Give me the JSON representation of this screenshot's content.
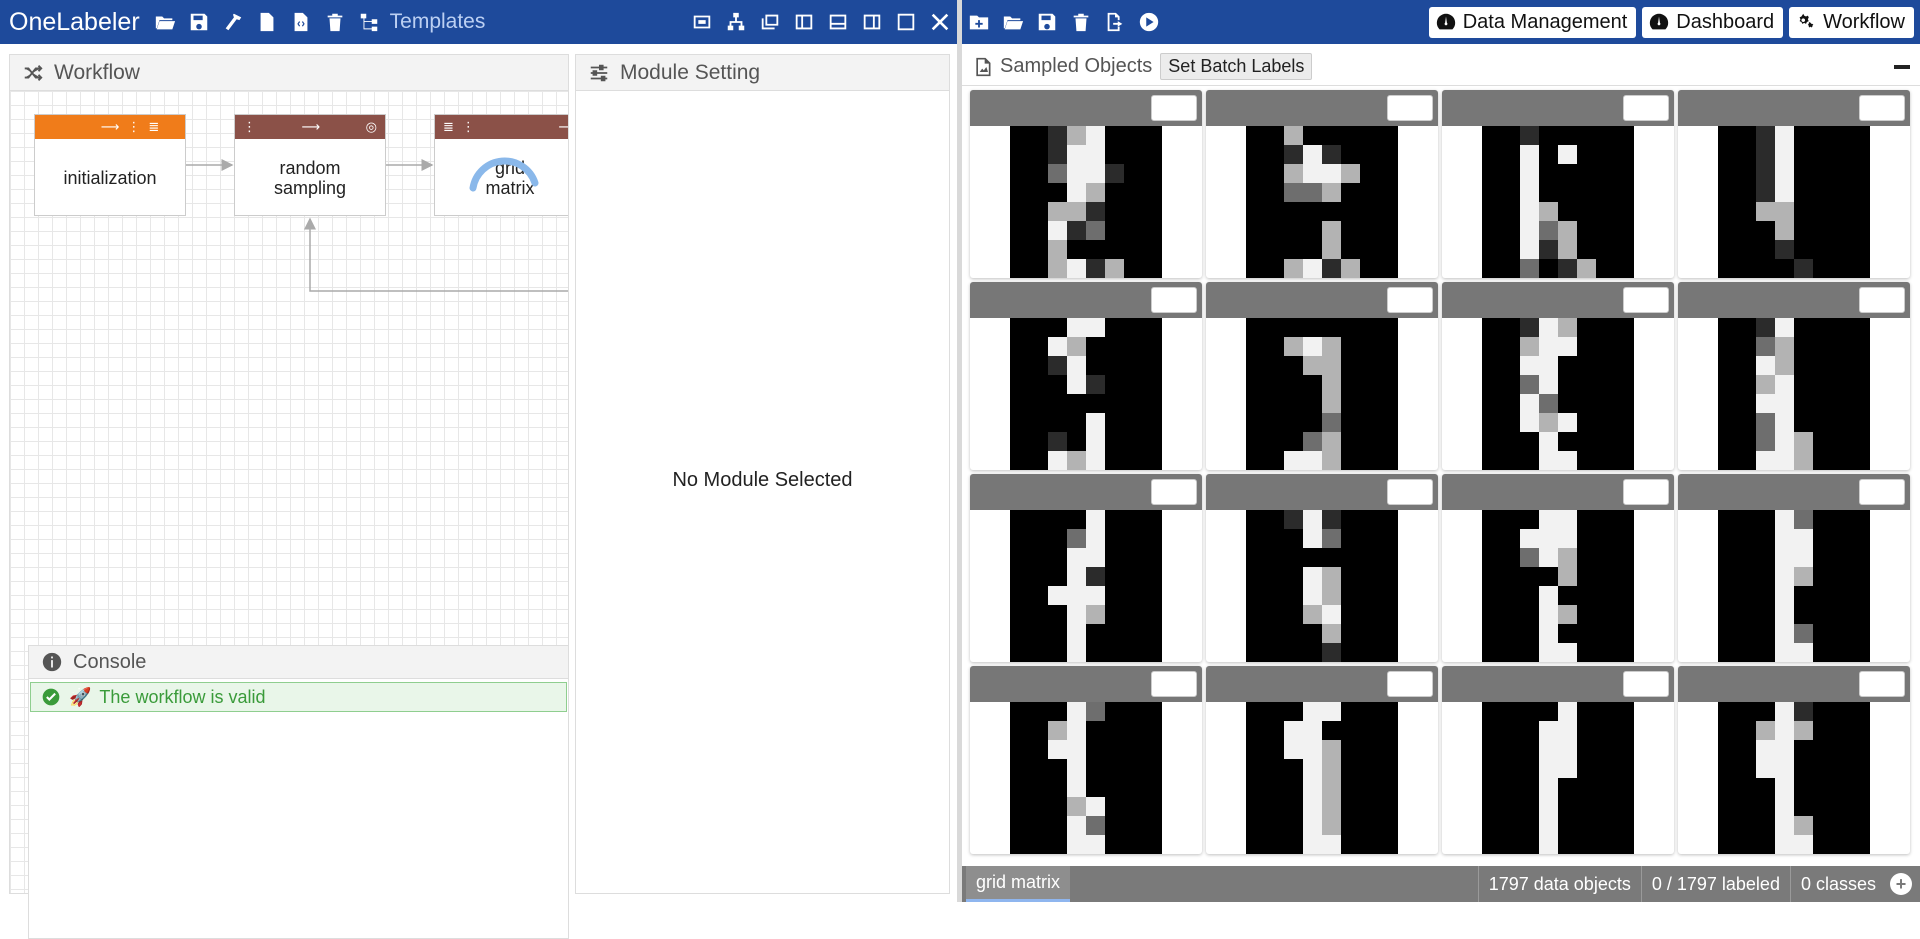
{
  "app": {
    "title": "OneLabeler",
    "templates_label": "Templates",
    "accent_color": "#1e4a9b"
  },
  "left_toolbar_icons": [
    "folder-open-icon",
    "save-icon",
    "hammer-icon",
    "file-icon",
    "file-code-icon",
    "trash-icon",
    "sitemap-icon"
  ],
  "window_controls": [
    "layout-grid-icon",
    "layout-tree-icon",
    "layout-window-icon",
    "layout-left-icon",
    "layout-bottom-icon",
    "layout-right-icon",
    "maximize-icon",
    "close-icon"
  ],
  "right_toolbar_icons": [
    "add-folder-icon",
    "folder-open-icon",
    "save-icon",
    "trash-icon",
    "export-icon",
    "play-icon"
  ],
  "nav": {
    "data_management": "Data Management",
    "dashboard": "Dashboard",
    "workflow": "Workflow"
  },
  "workflow_panel": {
    "title": "Workflow",
    "nodes": [
      {
        "label": "initialization",
        "color": "#f07c1a"
      },
      {
        "label": "random\nsampling",
        "color": "#8b5148"
      },
      {
        "label": "grid\nmatrix",
        "color": "#8b5148"
      }
    ]
  },
  "console": {
    "title": "Console",
    "message": "The workflow is valid",
    "message_color": "#3a9b3a"
  },
  "module_panel": {
    "title": "Module Setting",
    "empty_text": "No Module Selected"
  },
  "sampled": {
    "title": "Sampled Objects",
    "batch_button": "Set Batch Labels"
  },
  "digits": [
    [
      "00134000",
      "00144000",
      "00244100",
      "00043000",
      "00331000",
      "00412000",
      "00300000",
      "00341300"
    ],
    [
      "00300000",
      "00141000",
      "00344300",
      "00223000",
      "00000000",
      "00003000",
      "00003000",
      "00341300"
    ],
    [
      "00100000",
      "00404000",
      "00400000",
      "00400000",
      "00430000",
      "00423000",
      "00413000",
      "00201300"
    ],
    [
      "00140000",
      "00140000",
      "00140000",
      "00140000",
      "00330000",
      "00030000",
      "00010000",
      "00001000"
    ],
    [
      "00044000",
      "00430000",
      "00140000",
      "00041000",
      "00000000",
      "00004000",
      "00104000",
      "00434000"
    ],
    [
      "00000000",
      "00343000",
      "00033000",
      "00003000",
      "00003000",
      "00002000",
      "00023000",
      "00443000"
    ],
    [
      "00143000",
      "00344000",
      "00440000",
      "00240000",
      "00420000",
      "00434000",
      "00040000",
      "00044000"
    ],
    [
      "00140000",
      "00230000",
      "00430000",
      "00340000",
      "00440000",
      "00240000",
      "00243000",
      "00443000"
    ],
    [
      "00004000",
      "00024000",
      "00044000",
      "00041000",
      "00444000",
      "00043000",
      "00040000",
      "00040000"
    ],
    [
      "00141000",
      "00042000",
      "00000000",
      "00043000",
      "00043000",
      "00034000",
      "00003000",
      "00001000"
    ],
    [
      "00044000",
      "00444000",
      "00243000",
      "00003000",
      "00040000",
      "00043000",
      "00040000",
      "00044000"
    ],
    [
      "00042000",
      "00044000",
      "00044000",
      "00043000",
      "00040000",
      "00040000",
      "00042000",
      "00044000"
    ],
    [
      "00042000",
      "00340000",
      "00440000",
      "00040000",
      "00040000",
      "00034000",
      "00042000",
      "00044000"
    ],
    [
      "00044000",
      "00440000",
      "00443000",
      "00043000",
      "00043000",
      "00043000",
      "00043000",
      "00044000"
    ],
    [
      "00004000",
      "00044000",
      "00044000",
      "00044000",
      "00040000",
      "00040000",
      "00040000",
      "00040000"
    ],
    [
      "00041000",
      "00343000",
      "00440000",
      "00440000",
      "00040000",
      "00040000",
      "00043000",
      "00044000"
    ]
  ],
  "status": {
    "tab": "grid matrix",
    "data_objects": "1797 data objects",
    "labeled": "0 / 1797 labeled",
    "classes": "0 classes"
  }
}
